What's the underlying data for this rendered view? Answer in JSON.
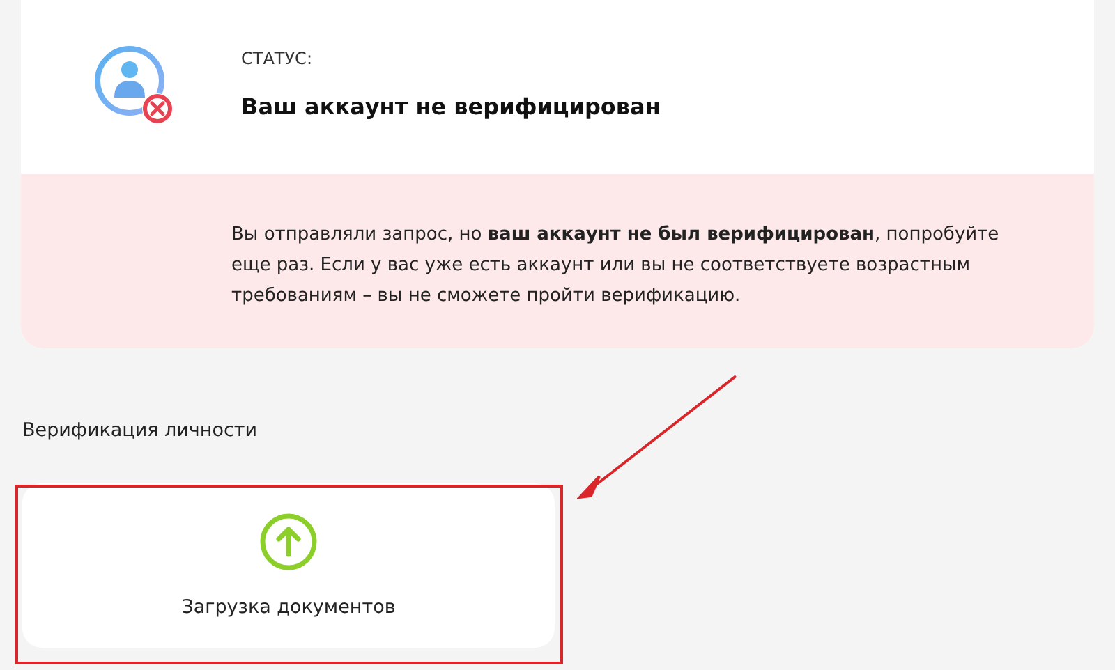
{
  "status_card": {
    "label": "СТАТУС:",
    "title": "Ваш аккаунт не верифицирован",
    "message": "Вы отправляли запрос, но **ваш аккаунт не был верифицирован**, попробуйте еще раз. Если у вас уже есть аккаунт или вы не соответствуете возрастным требованиям – вы не сможете пройти верификацию."
  },
  "section": {
    "title": "Верификация личности"
  },
  "upload": {
    "label": "Загрузка документов"
  }
}
